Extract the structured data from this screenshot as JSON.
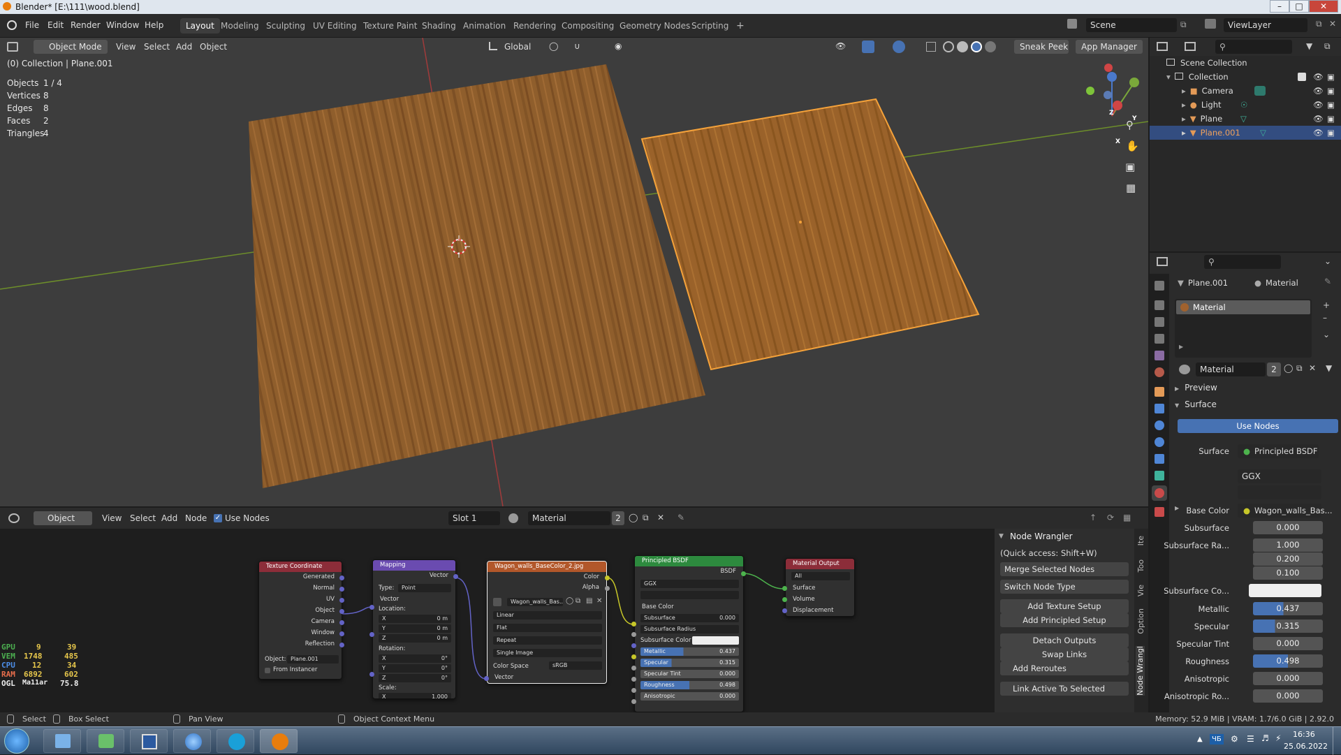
{
  "window": {
    "title": "Blender* [E:\\111\\wood.blend]"
  },
  "menubar": {
    "menus": [
      "File",
      "Edit",
      "Render",
      "Window",
      "Help"
    ],
    "workspaces": [
      "Layout",
      "Modeling",
      "Sculpting",
      "UV Editing",
      "Texture Paint",
      "Shading",
      "Animation",
      "Rendering",
      "Compositing",
      "Geometry Nodes",
      "Scripting"
    ],
    "active_workspace": "Layout",
    "add_tab": "+",
    "scene": "Scene",
    "view_layer": "ViewLayer"
  },
  "viewport": {
    "mode": "Object Mode",
    "menus": [
      "View",
      "Select",
      "Add",
      "Object"
    ],
    "orientation": "Global",
    "addon_buttons": [
      "Sneak Peek",
      "App Manager"
    ],
    "collection_label": "(0) Collection | Plane.001",
    "stats": [
      {
        "label": "Objects",
        "value": "1 / 4"
      },
      {
        "label": "Vertices",
        "value": "8"
      },
      {
        "label": "Edges",
        "value": "8"
      },
      {
        "label": "Faces",
        "value": "2"
      },
      {
        "label": "Triangles",
        "value": "4"
      }
    ],
    "colors": {
      "background": "#3d3d3d",
      "wood": "#8a5a2a",
      "selection": "#f5a23a",
      "x_axis": "#b13a3a",
      "y_axis": "#6f9a2a"
    },
    "gizmo_axes": [
      "Z",
      "Y",
      "X"
    ]
  },
  "overlay_monitor": {
    "rows": [
      {
        "label": "GPU",
        "a": "9",
        "b": "39"
      },
      {
        "label": "VEM",
        "a": "1748",
        "b": "485"
      },
      {
        "label": "CPU",
        "a": "12",
        "b": "34"
      },
      {
        "label": "RAM",
        "a": "6892",
        "b": "602"
      },
      {
        "label": "OGL",
        "a": "Ma11ar",
        "b": "75.8"
      }
    ]
  },
  "node_editor": {
    "editor_type": "Object",
    "menus": [
      "View",
      "Select",
      "Add",
      "Node"
    ],
    "use_nodes_label": "Use Nodes",
    "slot": "Slot 1",
    "material": "Material",
    "material_users": "2",
    "nodes": {
      "texcoord": {
        "title": "Texture Coordinate",
        "outputs": [
          "Generated",
          "Normal",
          "UV",
          "Object",
          "Camera",
          "Window",
          "Reflection"
        ],
        "object_label": "Object:",
        "object_value": "Plane.001",
        "from_instancer": "From Instancer"
      },
      "mapping": {
        "title": "Mapping",
        "output": "Vector",
        "type_label": "Type:",
        "type_value": "Point",
        "vector_label": "Vector",
        "location_label": "Location:",
        "loc": [
          {
            "axis": "X",
            "value": "0 m"
          },
          {
            "axis": "Y",
            "value": "0 m"
          },
          {
            "axis": "Z",
            "value": "0 m"
          }
        ],
        "rotation_label": "Rotation:",
        "rot": [
          {
            "axis": "X",
            "value": "0°"
          },
          {
            "axis": "Y",
            "value": "0°"
          },
          {
            "axis": "Z",
            "value": "0°"
          }
        ],
        "scale_label": "Scale:",
        "scale_x": {
          "axis": "X",
          "value": "1.000"
        }
      },
      "image": {
        "title": "Wagon_walls_BaseColor_2.jpg",
        "outputs": [
          "Color",
          "Alpha"
        ],
        "image_name": "Wagon_walls_Bas...",
        "interpolation": "Linear",
        "projection": "Flat",
        "extension": "Repeat",
        "source": "Single Image",
        "colorspace_label": "Color Space",
        "colorspace_value": "sRGB",
        "vector_label": "Vector"
      },
      "bsdf": {
        "title": "Principled BSDF",
        "output": "BSDF",
        "distribution": "GGX",
        "subsurface_method": "",
        "inputs": [
          {
            "label": "Base Color",
            "value": ""
          },
          {
            "label": "Subsurface",
            "value": "0.000"
          },
          {
            "label": "Subsurface Radius",
            "value": ""
          },
          {
            "label": "Subsurface Color",
            "value": ""
          },
          {
            "label": "Metallic",
            "value": "0.437"
          },
          {
            "label": "Specular",
            "value": "0.315"
          },
          {
            "label": "Specular Tint",
            "value": "0.000"
          },
          {
            "label": "Roughness",
            "value": "0.498"
          },
          {
            "label": "Anisotropic",
            "value": "0.000"
          }
        ]
      },
      "output": {
        "title": "Material Output",
        "target": "All",
        "inputs": [
          "Surface",
          "Volume",
          "Displacement"
        ]
      }
    }
  },
  "node_wrangler": {
    "title": "Node Wrangler",
    "quick_access": "(Quick access: Shift+W)",
    "merge": "Merge Selected Nodes",
    "switch": "Switch Node Type",
    "add_texture": "Add Texture Setup",
    "add_principled": "Add Principled Setup",
    "detach": "Detach Outputs",
    "swap": "Swap Links",
    "reroutes": "Add Reroutes",
    "link_active": "Link Active To Selected",
    "side_tabs": [
      "Ite",
      "Too",
      "Vie",
      "Option",
      "Node Wrangl"
    ]
  },
  "outliner": {
    "root": "Scene Collection",
    "collection": "Collection",
    "items": [
      {
        "name": "Camera",
        "icon": "camera-object-icon",
        "color": "#e39a57"
      },
      {
        "name": "Light",
        "icon": "light-object-icon",
        "color": "#e39a57"
      },
      {
        "name": "Plane",
        "icon": "mesh-object-icon",
        "color": "#e39a57"
      },
      {
        "name": "Plane.001",
        "icon": "mesh-object-icon",
        "color": "#e39a57"
      }
    ]
  },
  "properties": {
    "object": "Plane.001",
    "material_tab": "Material",
    "slot_name": "Material",
    "material_name": "Material",
    "users": "2",
    "preview_label": "Preview",
    "surface_panel": "Surface",
    "use_nodes": "Use Nodes",
    "surface_label": "Surface",
    "surface_value": "Principled BSDF",
    "distribution": "GGX",
    "base_color_label": "Base Color",
    "base_color_value": "Wagon_walls_Bas...",
    "rows": [
      {
        "label": "Subsurface",
        "value": "0.000",
        "fill": 0
      },
      {
        "label": "Subsurface Ra...",
        "value": "1.000",
        "fill": 0
      },
      {
        "label": "",
        "value": "0.200",
        "fill": 0
      },
      {
        "label": "",
        "value": "0.100",
        "fill": 0
      }
    ],
    "subsurface_color_label": "Subsurface Co...",
    "sliders": [
      {
        "label": "Metallic",
        "value": "0.437",
        "fill": 0.437
      },
      {
        "label": "Specular",
        "value": "0.315",
        "fill": 0.315
      },
      {
        "label": "Specular Tint",
        "value": "0.000",
        "fill": 0
      },
      {
        "label": "Roughness",
        "value": "0.498",
        "fill": 0.498
      },
      {
        "label": "Anisotropic",
        "value": "0.000",
        "fill": 0
      },
      {
        "label": "Anisotropic Ro...",
        "value": "0.000",
        "fill": 0
      }
    ]
  },
  "statusbar": {
    "select": "Select",
    "box_select": "Box Select",
    "pan": "Pan View",
    "context": "Object Context Menu",
    "memory": "Memory: 52.9 MiB | VRAM: 1.7/6.0 GiB | 2.92.0"
  },
  "taskbar": {
    "time": "16:36",
    "date": "25.06.2022",
    "lang": "ЧБ"
  }
}
